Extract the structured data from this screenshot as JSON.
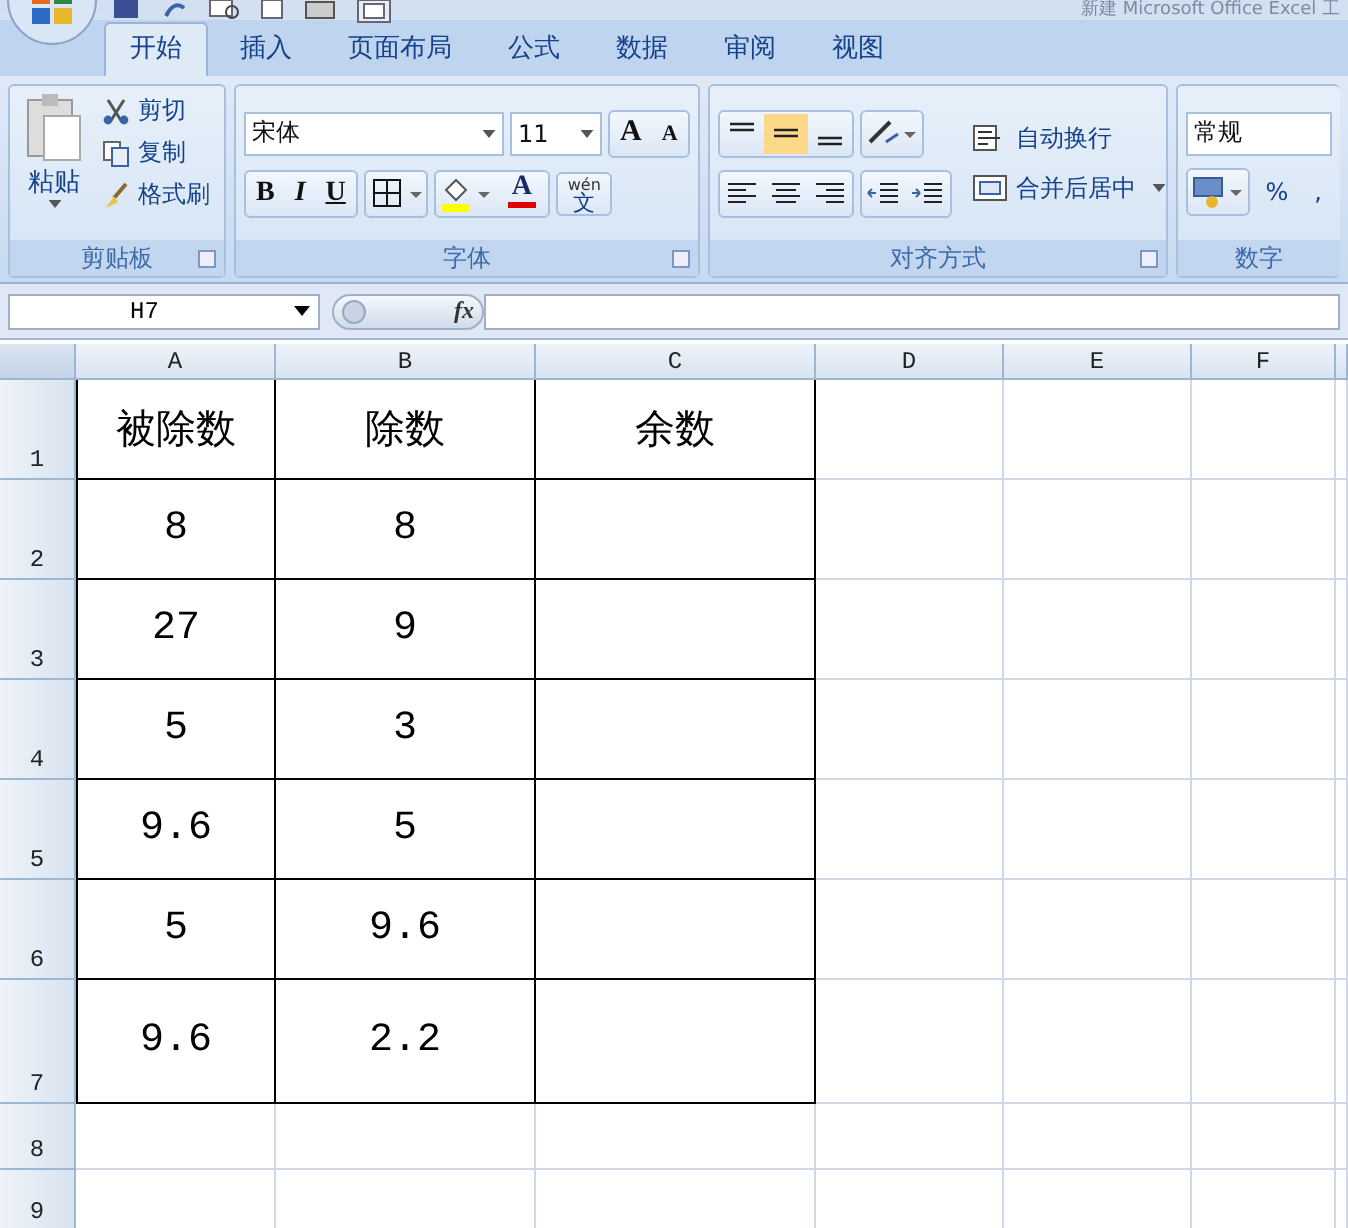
{
  "window": {
    "title": "新建 Microsoft Office Excel 工"
  },
  "tabs": [
    {
      "label": "开始",
      "selected": true
    },
    {
      "label": "插入",
      "selected": false
    },
    {
      "label": "页面布局",
      "selected": false
    },
    {
      "label": "公式",
      "selected": false
    },
    {
      "label": "数据",
      "selected": false
    },
    {
      "label": "审阅",
      "selected": false
    },
    {
      "label": "视图",
      "selected": false
    }
  ],
  "clipboard": {
    "paste": "粘贴",
    "actions": [
      "剪切",
      "复制",
      "格式刷"
    ],
    "label": "剪贴板"
  },
  "font": {
    "name": "宋体",
    "size": "11",
    "grow": "A",
    "shrink": "A",
    "styles": [
      "B",
      "I",
      "U"
    ],
    "color_glyph": "A",
    "phonetic_top": "wén",
    "phonetic_bottom": "文",
    "label": "字体"
  },
  "alignment": {
    "vertical": [
      {
        "selected": false
      },
      {
        "selected": true
      },
      {
        "selected": false
      }
    ],
    "wrap": "自动换行",
    "merge": "合并后居中",
    "label": "对齐方式"
  },
  "number": {
    "format": "常规",
    "percent": "%",
    "comma": ",",
    "label": "数字"
  },
  "formula_bar": {
    "name_box": "H7",
    "fx": "fx"
  },
  "sheet": {
    "columns": [
      "A",
      "B",
      "C",
      "D",
      "E",
      "F"
    ],
    "rows": [
      {
        "number": "1",
        "cells": [
          "被除数",
          "除数",
          "余数"
        ]
      },
      {
        "number": "2",
        "cells": [
          "8",
          "8",
          ""
        ]
      },
      {
        "number": "3",
        "cells": [
          "27",
          "9",
          ""
        ]
      },
      {
        "number": "4",
        "cells": [
          "5",
          "3",
          ""
        ]
      },
      {
        "number": "5",
        "cells": [
          "9.6",
          "5",
          ""
        ]
      },
      {
        "number": "6",
        "cells": [
          "5",
          "9.6",
          ""
        ]
      },
      {
        "number": "7",
        "cells": [
          "9.6",
          "2.2",
          ""
        ]
      },
      {
        "number": "8",
        "cells": []
      },
      {
        "number": "9",
        "cells": []
      }
    ]
  }
}
